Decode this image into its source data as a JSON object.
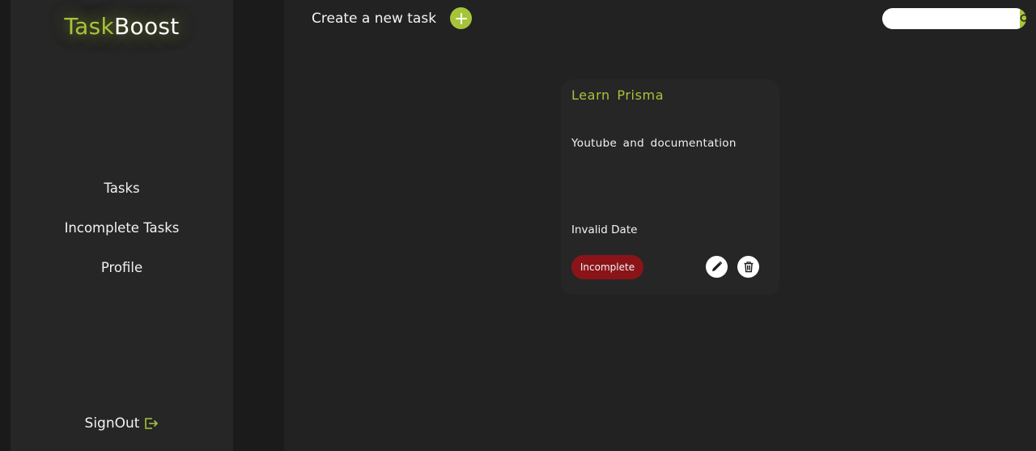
{
  "brand": {
    "part1": "Task",
    "part2": "Boost"
  },
  "sidebar": {
    "items": [
      {
        "label": "Tasks"
      },
      {
        "label": "Incomplete Tasks"
      },
      {
        "label": "Profile"
      }
    ],
    "signout_label": "SignOut"
  },
  "toolbar": {
    "create_label": "Create a new task",
    "add_icon": "plus-icon"
  },
  "search": {
    "value": "",
    "placeholder": "",
    "icon": "search-icon"
  },
  "tasks": [
    {
      "title": "Learn  Prisma",
      "description": "Youtube  and  documentation",
      "date": "Invalid Date",
      "status": "Incomplete"
    }
  ],
  "colors": {
    "accent": "#a6c43a",
    "incomplete": "#8b1419",
    "background": "#222222",
    "sidebar": "#262626"
  }
}
